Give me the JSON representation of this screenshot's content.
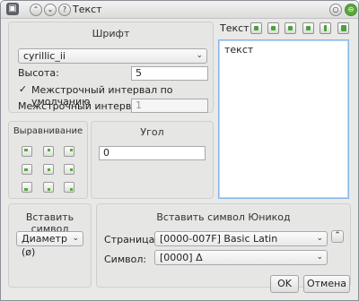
{
  "window": {
    "title": "Текст",
    "app_icon": "terminal-icon"
  },
  "font_panel": {
    "title": "Шрифт",
    "font_value": "cyrillic_ii",
    "height_label": "Высота:",
    "height_value": "5",
    "default_spacing_label": "Межстрочный интервал по умолчанию",
    "default_spacing_checked": true,
    "spacing_label": "Межстрочный интервал:",
    "spacing_value": "1"
  },
  "align_panel": {
    "title": "Выравнивание"
  },
  "angle_panel": {
    "title": "Угол",
    "angle_value": "0"
  },
  "text_panel": {
    "label": "Текст:",
    "content": "текст",
    "toolbar": [
      "open-icon",
      "folder-icon",
      "save-icon",
      "insert-icon",
      "column-icon",
      "green-arrow-icon"
    ]
  },
  "insert_symbol_panel": {
    "title": "Вставить символ",
    "value": "Диаметр (ø)"
  },
  "unicode_panel": {
    "title": "Вставить символ Юникод",
    "page_label": "Страница:",
    "page_value": "[0000-007F] Basic Latin",
    "symbol_label": "Символ:",
    "symbol_value": "[0000] Δ"
  },
  "buttons": {
    "ok": "OK",
    "cancel": "Отмена"
  }
}
